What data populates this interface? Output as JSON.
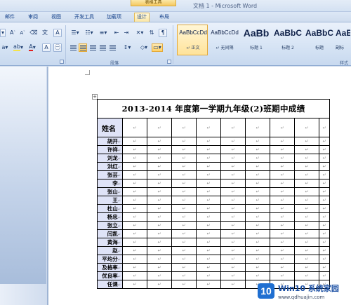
{
  "window": {
    "title": "文档 1 - Microsoft Word",
    "contextual_tab_label": "表格工具"
  },
  "tabs": [
    {
      "label": "邮件"
    },
    {
      "label": "审阅"
    },
    {
      "label": "视图"
    },
    {
      "label": "开发工具"
    },
    {
      "label": "加载项"
    },
    {
      "label": "设计"
    },
    {
      "label": "布局"
    }
  ],
  "ribbon": {
    "groups": {
      "paragraph": "段落",
      "styles": "样式"
    },
    "styles_gallery": [
      {
        "sample": "AaBbCcDd",
        "name": "↵ 正文",
        "selected": true
      },
      {
        "sample": "AaBbCcDd",
        "name": "↵ 无间隔",
        "selected": false
      },
      {
        "sample": "AaBb",
        "name": "标题 1",
        "selected": false
      },
      {
        "sample": "AaBbC",
        "name": "标题 2",
        "selected": false
      },
      {
        "sample": "AaBbC",
        "name": "标题",
        "selected": false
      },
      {
        "sample": "AaE",
        "name": "副标",
        "selected": false
      }
    ]
  },
  "document": {
    "table_title": "2013-2014 年度第一学期九年级(2)班期中成绩",
    "header_label": "姓名",
    "cell_mark": "↵",
    "rows": [
      "胡开",
      "许祥",
      "刘龙",
      "洪红",
      "张芸",
      "李",
      "张山",
      "王",
      "杜山",
      "杨忠",
      "张立",
      "闫凯",
      "黄海",
      "赵",
      "平均分",
      "及格率",
      "优良率",
      "任课"
    ]
  },
  "watermark": {
    "badge": "10",
    "title": "Win10 系统家园",
    "url": "www.qdhuajin.com"
  }
}
